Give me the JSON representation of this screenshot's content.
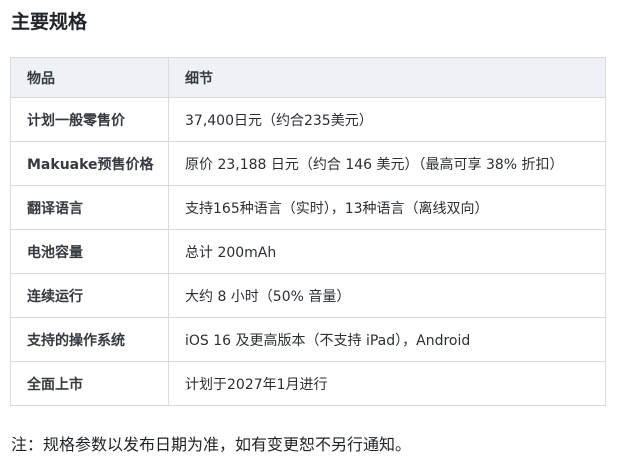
{
  "title": "主要规格",
  "table": {
    "headers": [
      "物品",
      "细节"
    ],
    "rows": [
      {
        "item": "计划一般零售价",
        "detail": "37,400日元（约合235美元）"
      },
      {
        "item": "Makuake预售价格",
        "detail": "原价 23,188 日元（约合 146 美元）（最高可享 38% 折扣）"
      },
      {
        "item": "翻译语言",
        "detail": "支持165种语言（实时），13种语言（离线双向）"
      },
      {
        "item": "电池容量",
        "detail": "总计 200mAh"
      },
      {
        "item": "连续运行",
        "detail": "大约 8 小时（50% 音量）"
      },
      {
        "item": "支持的操作系统",
        "detail": "iOS 16 及更高版本（不支持 iPad），Android"
      },
      {
        "item": "全面上市",
        "detail": "计划于2027年1月进行"
      }
    ]
  },
  "note": "注：规格参数以发布日期为准，如有变更恕不另行通知。"
}
